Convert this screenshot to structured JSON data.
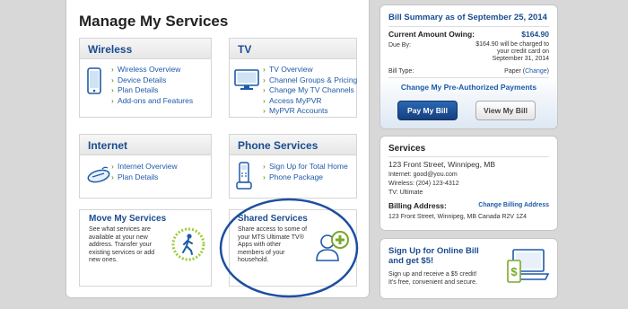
{
  "main": {
    "title": "Manage My Services",
    "wireless": {
      "title": "Wireless",
      "links": [
        "Wireless Overview",
        "Device Details",
        "Plan Details",
        "Add-ons and Features"
      ]
    },
    "tv": {
      "title": "TV",
      "links": [
        "TV Overview",
        "Channel Groups & Pricing",
        "Change My TV Channels",
        "Access MyPVR",
        "MyPVR Accounts"
      ]
    },
    "internet": {
      "title": "Internet",
      "links": [
        "Internet Overview",
        "Plan Details"
      ]
    },
    "phone": {
      "title": "Phone Services",
      "links": [
        "Sign Up for Total Home",
        "Phone Package"
      ]
    },
    "move": {
      "title": "Move My Services",
      "lines": [
        "See what services are",
        "available at your new",
        "address. Transfer your",
        "existing services or add",
        "new ones."
      ]
    },
    "shared": {
      "title": "Shared Services",
      "lines": [
        "Share access to some of",
        "your MTS Ultimate TV®",
        "Apps with other",
        "members of your",
        "household."
      ]
    }
  },
  "bill": {
    "title": "Bill Summary as of September 25, 2014",
    "current_label": "Current Amount Owing:",
    "current_value": "$164.90",
    "due_label": "Due By:",
    "due_lines": [
      "$164.90 will be charged to",
      "your credit card on",
      "September 31, 2014"
    ],
    "type_label": "Bill Type:",
    "type_value": "Paper",
    "type_change": "Change",
    "preauth_link": "Change My Pre-Authorized Payments",
    "pay_button": "Pay My Bill",
    "view_button": "View My Bill"
  },
  "services": {
    "title": "Services",
    "address": "123 Front Street, Winnipeg, MB",
    "internet": "Internet: good@you.com",
    "wireless": "Wireless: (204) 123-4312",
    "tv": "TV: Ultimate",
    "billing_label": "Billing Address:",
    "billing_change": "Change Billing Address",
    "billing_address": "123 Front Street, Winnipeg, MB Canada R2V 1Z4"
  },
  "online": {
    "title_lines": [
      "Sign Up for Online Bill",
      "and get $5!"
    ],
    "text_lines": [
      "Sign up and receive a $5 credit!",
      "It's free, convenient and secure."
    ]
  },
  "colors": {
    "brand_blue": "#1a4c8f",
    "link_blue": "#1e5aa8",
    "accent_green": "#7aa82c",
    "circle": "#1d4fa0"
  }
}
